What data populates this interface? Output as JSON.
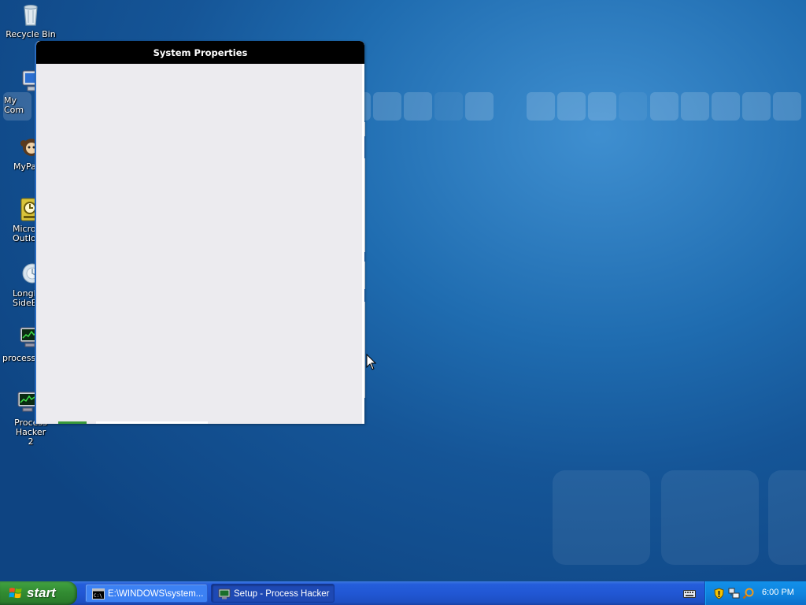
{
  "desktop": {
    "icons": [
      {
        "label": "Recycle Bin",
        "icon": "recycle-bin-icon"
      },
      {
        "label": "My Com",
        "icon": "my-computer-icon"
      },
      {
        "label": "MyPa",
        "icon": "mypal-icon"
      },
      {
        "label": "Micros\nOutlo",
        "icon": "outlook-icon"
      },
      {
        "label": "Longh\nSideB",
        "icon": "sidebar-icon"
      },
      {
        "label": "processh",
        "icon": "process-hacker-icon"
      },
      {
        "label": "Process Hacker\n2",
        "icon": "process-hacker-2-icon"
      }
    ]
  },
  "window": {
    "title": "System Properties",
    "progress_fraction": 0.19
  },
  "taskbar": {
    "start_label": "start",
    "tasks": [
      {
        "label": "E:\\WINDOWS\\system...",
        "icon": "cmd-icon",
        "active": false
      },
      {
        "label": "Setup - Process Hacker",
        "icon": "setup-icon",
        "active": true
      }
    ],
    "tray": {
      "icons": [
        "keyboard-icon",
        "security-shield-icon",
        "network-icon",
        "search-icon"
      ],
      "clock": "6:00 PM"
    }
  },
  "colors": {
    "desktop_bg": "#1f6cb0",
    "taskbar": "#245edb",
    "start_button": "#318a31",
    "tray": "#0f85e0",
    "window_title": "#000000",
    "window_body": "#ecebef"
  }
}
